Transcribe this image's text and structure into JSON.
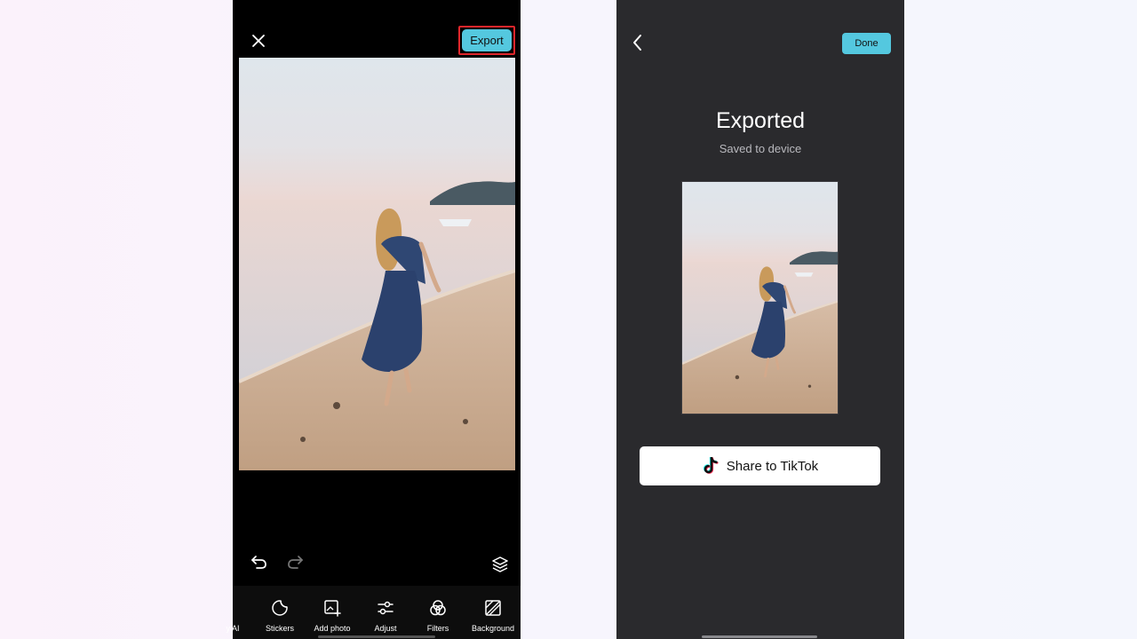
{
  "editor": {
    "export_label": "Export",
    "tools": [
      {
        "label": "y AI",
        "icon": "ai-icon"
      },
      {
        "label": "Stickers",
        "icon": "sticker-icon"
      },
      {
        "label": "Add photo",
        "icon": "add-photo-icon"
      },
      {
        "label": "Adjust",
        "icon": "sliders-icon"
      },
      {
        "label": "Filters",
        "icon": "filters-icon"
      },
      {
        "label": "Background",
        "icon": "background-icon"
      }
    ],
    "colors": {
      "accent": "#54c8df",
      "highlight": "#e0262b"
    }
  },
  "result": {
    "done_label": "Done",
    "title": "Exported",
    "subtitle": "Saved to device",
    "share_label": "Share to TikTok",
    "share_icon": "tiktok-icon"
  }
}
